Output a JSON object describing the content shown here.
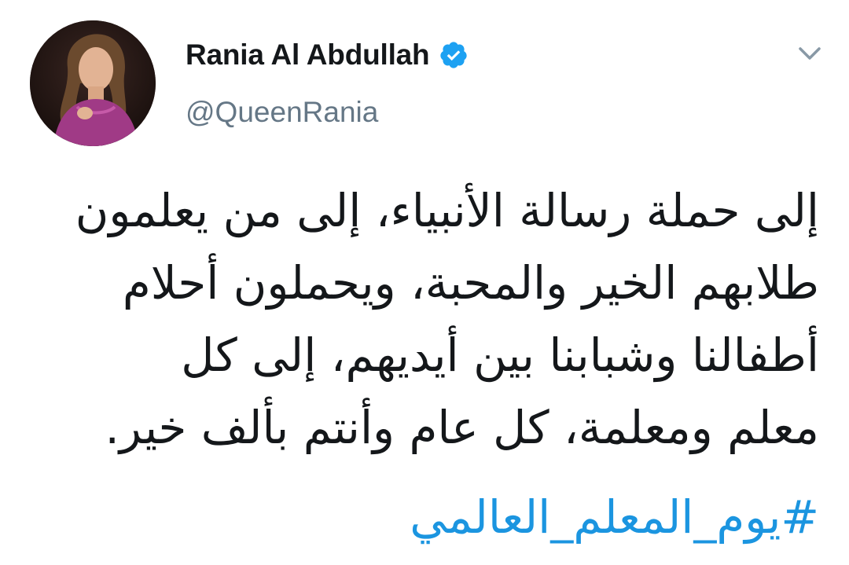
{
  "tweet": {
    "author": {
      "display_name": "Rania Al Abdullah",
      "handle": "@QueenRania",
      "verified": true
    },
    "text_lines": [
      "إلى حملة رسالة الأنبياء، إلى من يعلمون",
      "طلابهم الخير والمحبة، ويحملون أحلام",
      "أطفالنا وشبابنا بين أيديهم، إلى كل",
      "معلم ومعلمة، كل عام وأنتم بألف خير."
    ],
    "hashtag": "#يوم_المعلم_العالمي"
  },
  "icons": {
    "verified": "verified-badge-icon",
    "menu": "chevron-down-icon"
  },
  "colors": {
    "text": "#14171a",
    "secondary": "#657786",
    "link": "#1b95e0",
    "verified": "#1da1f2"
  }
}
